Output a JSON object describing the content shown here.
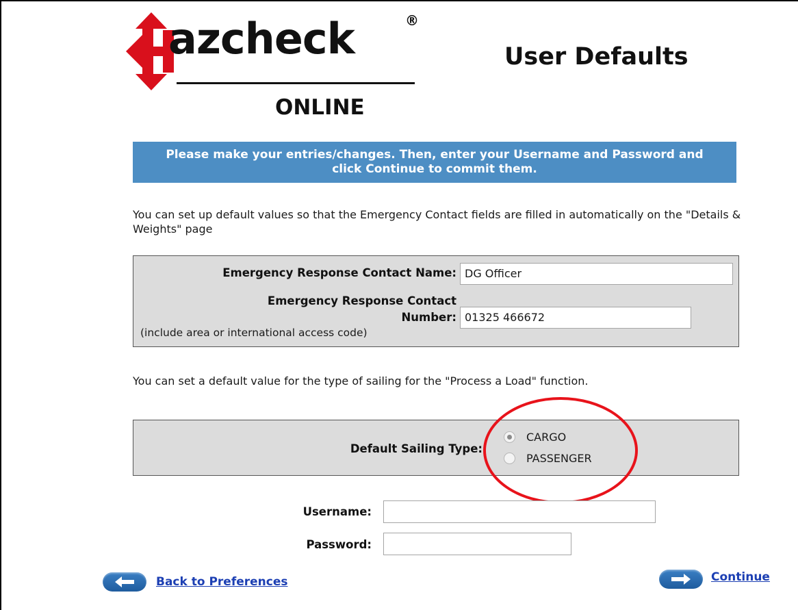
{
  "header": {
    "logo_text": "azcheck",
    "logo_registered": "®",
    "logo_subtext": "ONLINE",
    "page_title": "User Defaults"
  },
  "banner": {
    "message": "Please make your entries/changes. Then, enter your Username and Password and click Continue to commit them."
  },
  "contact_section": {
    "intro": "You can set up default values so that the Emergency Contact fields are filled in automatically on the \"Details & Weights\" page",
    "name_label": "Emergency Response Contact Name:",
    "name_value": "DG Officer",
    "number_label_line1": "Emergency Response Contact",
    "number_label_line2": "Number:",
    "number_note": "(include area or international access code)",
    "number_value": "01325 466672"
  },
  "sailing_section": {
    "intro": "You can set a default value for the type of sailing for the \"Process a Load\" function.",
    "label": "Default Sailing Type:",
    "options": [
      {
        "label": "CARGO",
        "selected": true
      },
      {
        "label": "PASSENGER",
        "selected": false
      }
    ]
  },
  "credentials": {
    "username_label": "Username:",
    "username_value": "",
    "password_label": "Password:",
    "password_value": ""
  },
  "navigation": {
    "back_label": "Back to Preferences",
    "continue_label": "Continue"
  },
  "colors": {
    "banner_bg": "#4d8ec4",
    "panel_bg": "#dcdcdc",
    "logo_red": "#d9101c",
    "highlight": "#e8131b",
    "link": "#1c3fb3"
  }
}
